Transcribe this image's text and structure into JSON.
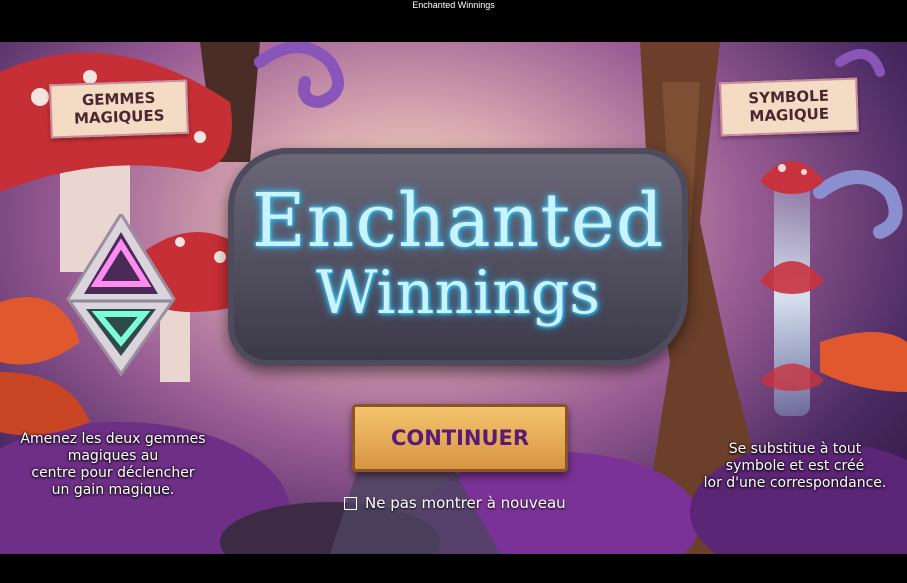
{
  "window": {
    "title": "Enchanted Winnings"
  },
  "logo": {
    "line1": "Enchanted",
    "line2": "Winnings"
  },
  "left_panel": {
    "badge": [
      "GEMMES",
      "MAGIQUES"
    ],
    "description": [
      "Amenez les deux gemmes",
      "magiques au",
      "centre pour déclencher",
      "un gain magique."
    ],
    "icon": "magic-gem-icon"
  },
  "right_panel": {
    "badge": [
      "SYMBOLE",
      "MAGIQUE"
    ],
    "description": [
      "Se substitue à tout",
      "symbole et est créé",
      "lor d'une correspondance."
    ],
    "icon": "magic-symbol-icon"
  },
  "continue_button": {
    "label": "CONTINUER"
  },
  "dont_show_again": {
    "label": "Ne pas montrer à nouveau",
    "checked": false
  },
  "colors": {
    "button_text": "#5a1a76",
    "logo_glow": "#59d6ff",
    "badge_bg": "#f3dcc3"
  }
}
